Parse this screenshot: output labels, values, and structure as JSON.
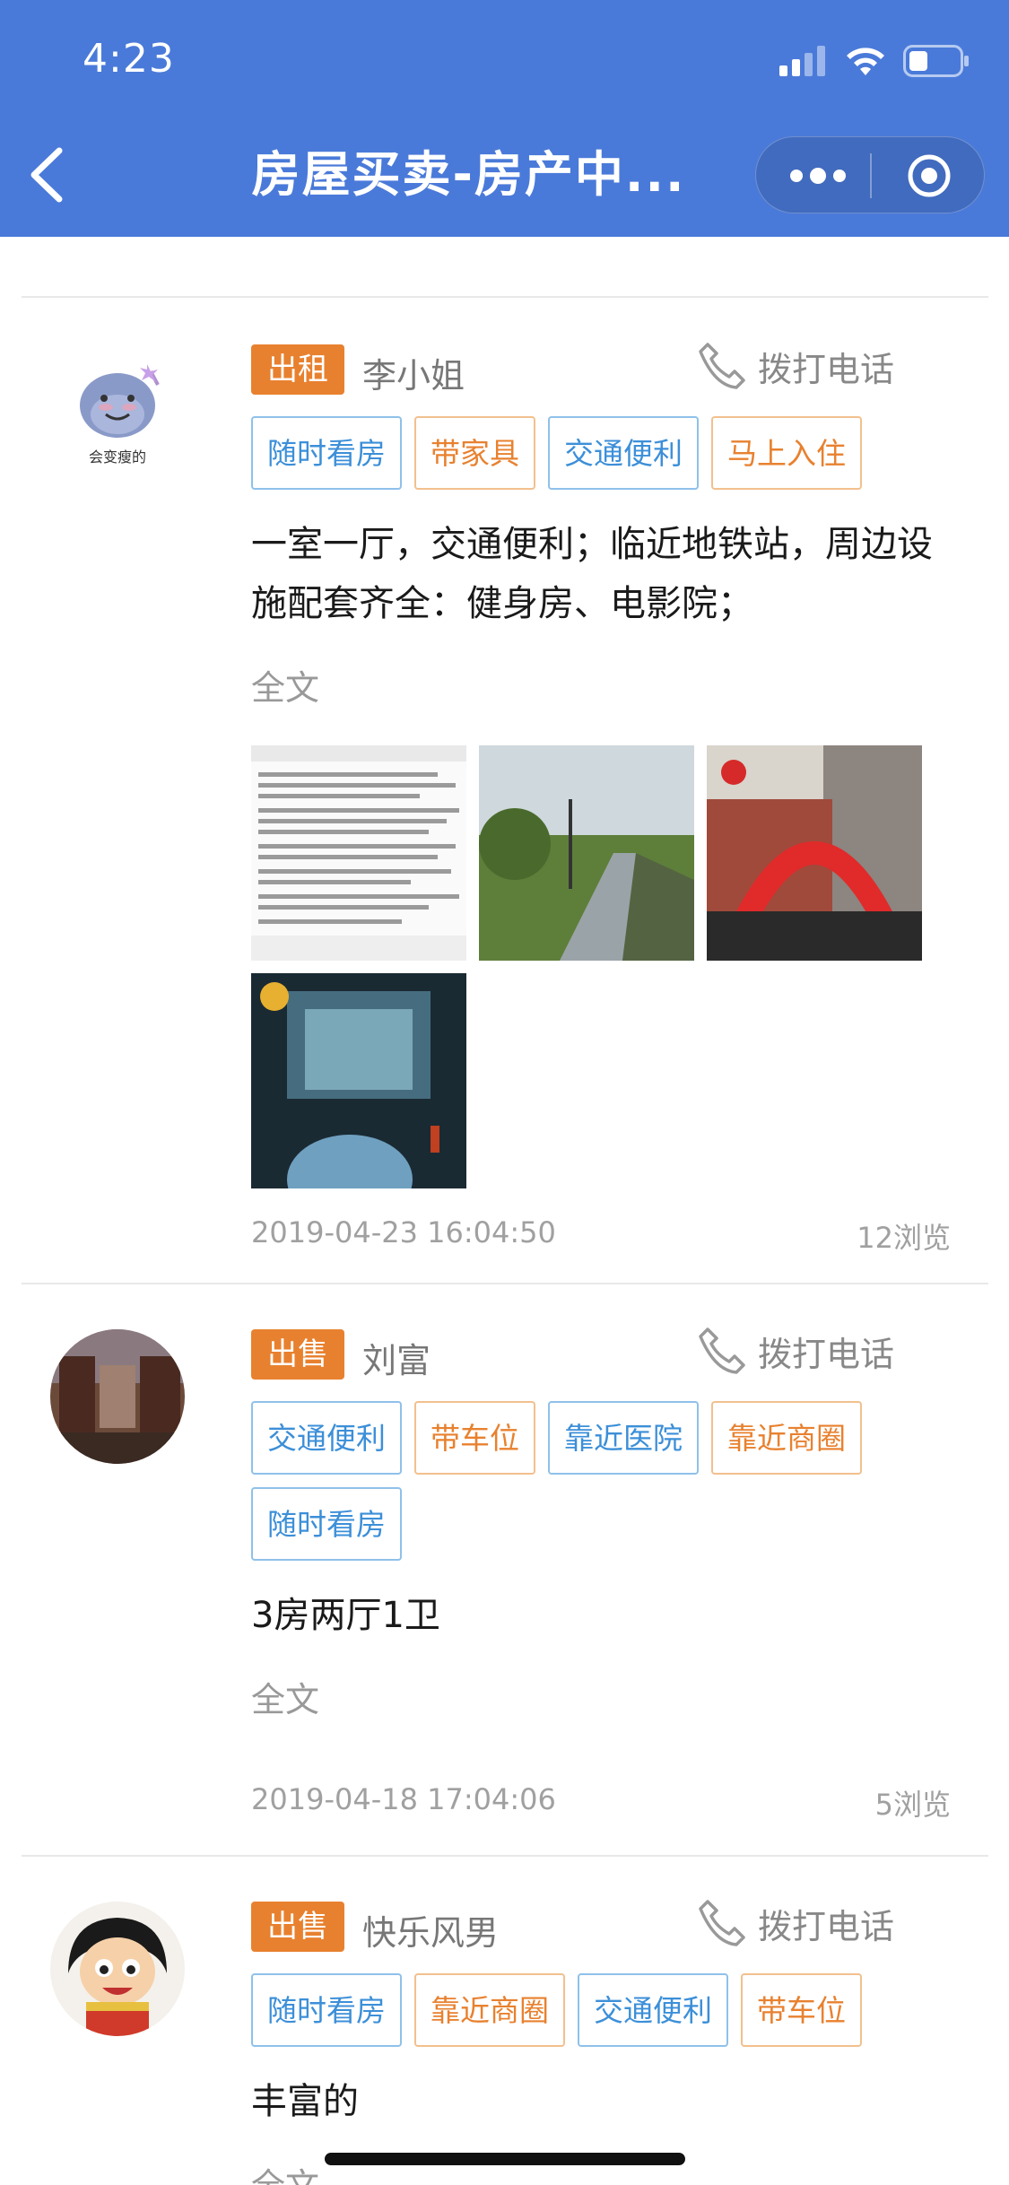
{
  "status_bar": {
    "time": "4:23"
  },
  "nav": {
    "title": "房屋买卖-房产中..."
  },
  "call_label": "拨打电话",
  "full_text_label": "全文",
  "colors": {
    "header": "#4a7ad9",
    "badge": "#e8812f",
    "tag_blue": "#3c8fd8",
    "tag_orange": "#e8812f"
  },
  "posts": [
    {
      "type": "出租",
      "name": "李小姐",
      "avatar_text": "会变瘦的",
      "tags": [
        "随时看房",
        "带家具",
        "交通便利",
        "马上入住"
      ],
      "description": "一室一厅，交通便利；临近地铁站，周边设施配套齐全：健身房、电影院；",
      "timestamp": "2019-04-23 16:04:50",
      "views": "12浏览"
    },
    {
      "type": "出售",
      "name": "刘富",
      "tags": [
        "交通便利",
        "带车位",
        "靠近医院",
        "靠近商圈",
        "随时看房"
      ],
      "description": "3房两厅1卫",
      "timestamp": "2019-04-18 17:04:06",
      "views": "5浏览"
    },
    {
      "type": "出售",
      "name": "快乐风男",
      "tags": [
        "随时看房",
        "靠近商圈",
        "交通便利",
        "带车位"
      ],
      "description": "丰富的"
    }
  ]
}
